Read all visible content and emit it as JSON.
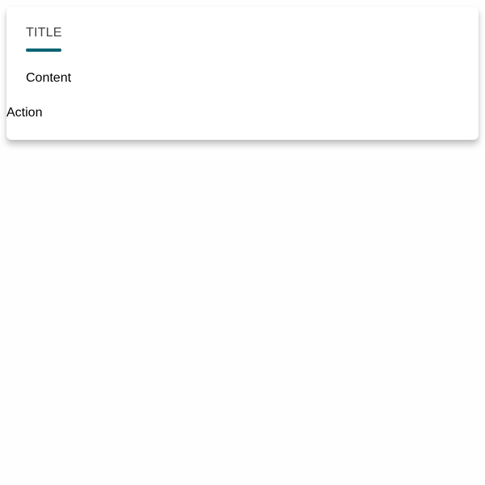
{
  "card": {
    "title": "TITLE",
    "content": "Content",
    "action_label": "Action"
  },
  "colors": {
    "accent": "#0b6474",
    "title_text": "#444444",
    "body_text": "#000000",
    "card_background": "#ffffff",
    "page_background": "#fefefe"
  }
}
